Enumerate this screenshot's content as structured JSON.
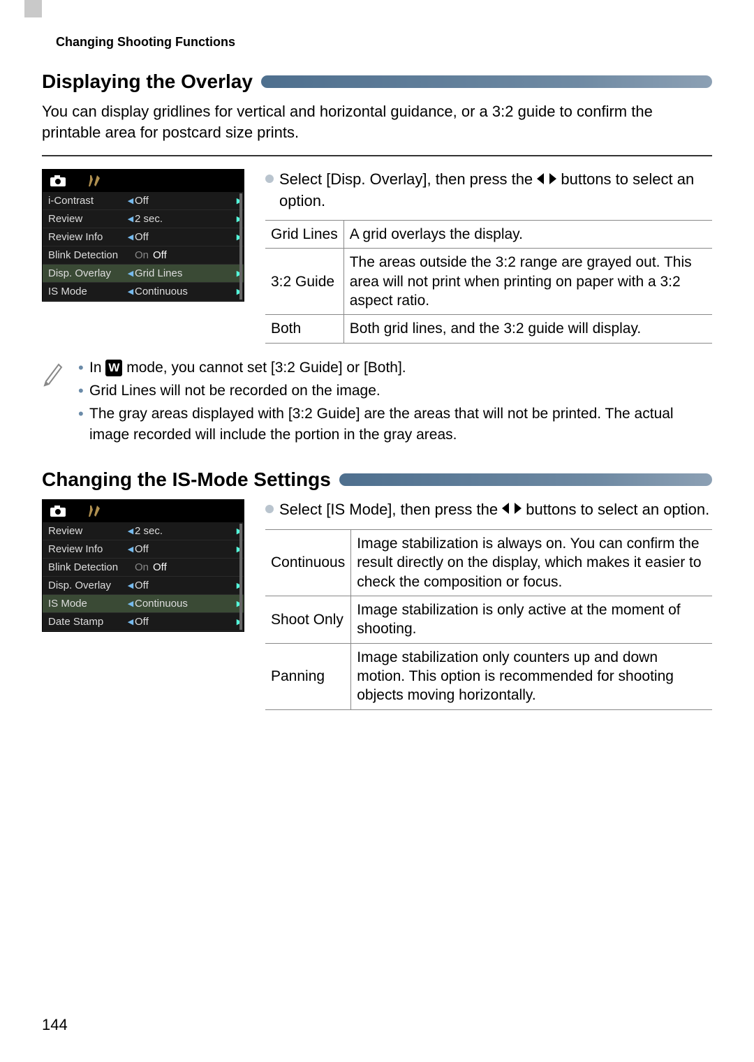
{
  "header_small": "Changing Shooting Functions",
  "section1": {
    "title": "Displaying the Overlay",
    "intro": "You can display gridlines for vertical and horizontal guidance, or a 3:2 guide to confirm the printable area for postcard size prints.",
    "step_pre": "Select [Disp. Overlay], then press the ",
    "step_post": " buttons to select an option.",
    "menu": [
      {
        "label": "i-Contrast",
        "val": "Off",
        "sel": false,
        "tri": true
      },
      {
        "label": "Review",
        "val": "2 sec.",
        "sel": false,
        "tri": true
      },
      {
        "label": "Review Info",
        "val": "Off",
        "sel": false,
        "tri": true
      },
      {
        "label": "Blink Detection",
        "val": "On  Off",
        "sel": false,
        "onoff": true
      },
      {
        "label": "Disp. Overlay",
        "val": "Grid Lines",
        "sel": true,
        "tri": true
      },
      {
        "label": "IS Mode",
        "val": "Continuous",
        "sel": false,
        "tri": true
      }
    ],
    "table": [
      {
        "k": "Grid Lines",
        "v": "A grid overlays the display."
      },
      {
        "k": "3:2 Guide",
        "v": "The areas outside the 3:2 range are grayed out. This area will not print when printing on paper with a 3:2 aspect ratio."
      },
      {
        "k": "Both",
        "v": "Both grid lines, and the 3:2 guide will display."
      }
    ],
    "notes": {
      "n1_pre": "In ",
      "n1_post": " mode, you cannot set [3:2 Guide] or [Both].",
      "n2": "Grid Lines will not be recorded on the image.",
      "n3": "The gray areas displayed with [3:2 Guide] are the areas that will not be printed. The actual image recorded will include the portion in the gray areas."
    }
  },
  "section2": {
    "title": "Changing the IS-Mode Settings",
    "step_pre": "Select [IS Mode], then press the ",
    "step_post": " buttons to select an option.",
    "menu": [
      {
        "label": "Review",
        "val": "2 sec.",
        "sel": false,
        "tri": true
      },
      {
        "label": "Review Info",
        "val": "Off",
        "sel": false,
        "tri": true
      },
      {
        "label": "Blink Detection",
        "val": "On  Off",
        "sel": false,
        "onoff": true
      },
      {
        "label": "Disp. Overlay",
        "val": "Off",
        "sel": false,
        "tri": true
      },
      {
        "label": "IS Mode",
        "val": "Continuous",
        "sel": true,
        "tri": true
      },
      {
        "label": "Date Stamp",
        "val": "Off",
        "sel": false,
        "tri": true
      }
    ],
    "table": [
      {
        "k": "Continuous",
        "v": "Image stabilization is always on. You can confirm the result directly on the display, which makes it easier to check the composition or focus."
      },
      {
        "k": "Shoot Only",
        "v": "Image stabilization is only active at the moment of shooting."
      },
      {
        "k": "Panning",
        "v": "Image stabilization only counters up and down motion. This option is recommended for shooting objects moving horizontally."
      }
    ]
  },
  "w_label": "W",
  "page": "144"
}
